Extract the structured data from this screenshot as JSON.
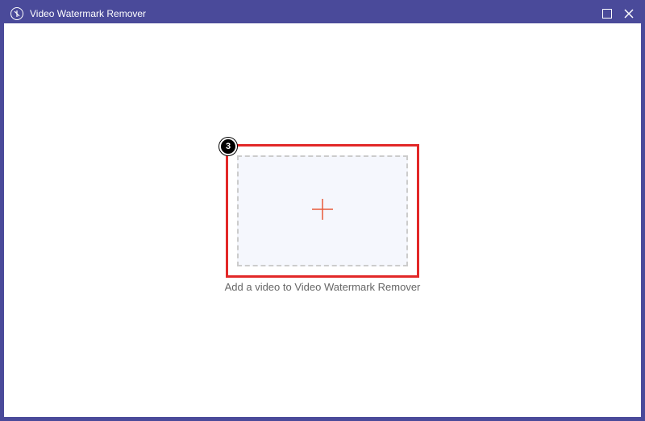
{
  "window": {
    "title": "Video Watermark Remover"
  },
  "dropzone": {
    "hint": "Add a video to Video Watermark Remover"
  },
  "annotation": {
    "step": "3"
  }
}
